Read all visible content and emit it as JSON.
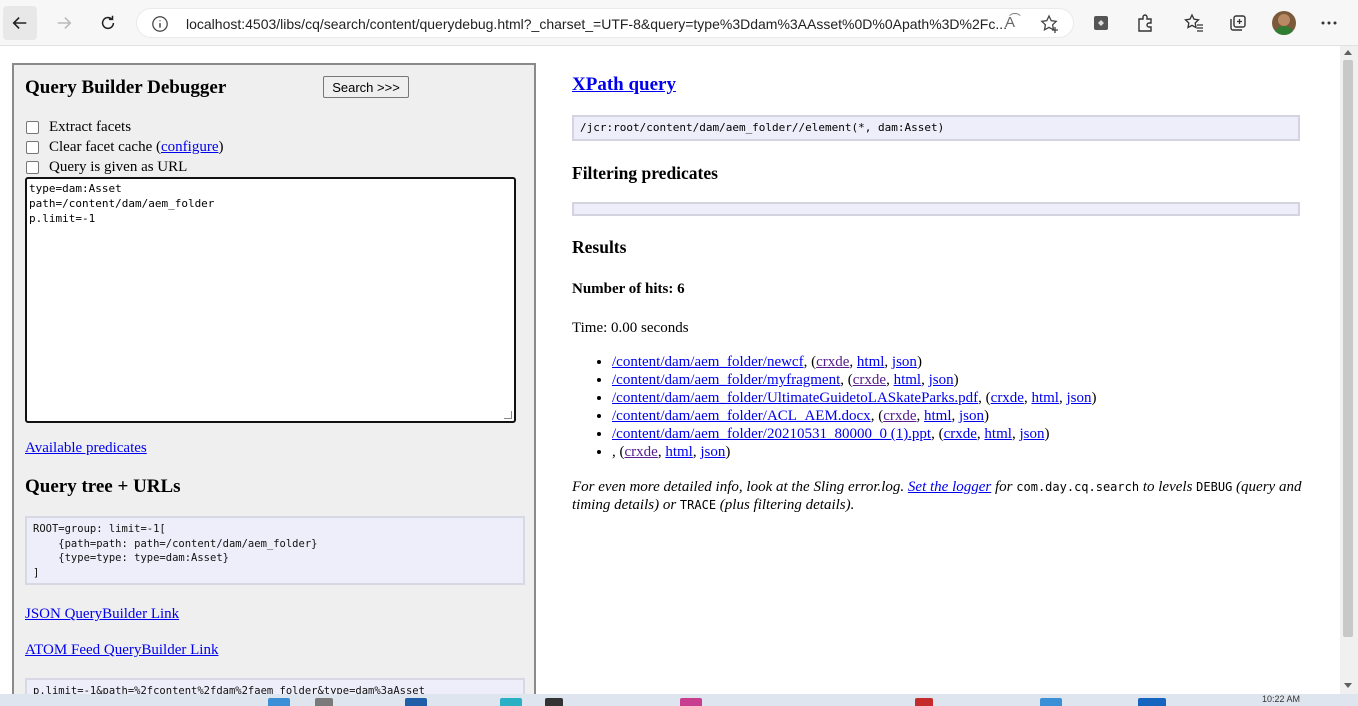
{
  "browser": {
    "url": "localhost:4503/libs/cq/search/content/querydebug.html?_charset_=UTF-8&query=type%3Ddam%3AAsset%0D%0Apath%3D%2Fc...",
    "reader_label": "A͡"
  },
  "left": {
    "title": "Query Builder Debugger",
    "search_button": "Search >>>",
    "checkboxes": {
      "extract": "Extract facets",
      "clear_prefix": "Clear facet cache (",
      "configure": "configure",
      "clear_suffix": ")",
      "url": "Query is given as URL"
    },
    "query_text": "type=dam:Asset\npath=/content/dam/aem_folder\np.limit=-1",
    "available_predicates": "Available predicates",
    "tree_heading": "Query tree + URLs",
    "tree_text": "ROOT=group: limit=-1[\n    {path=path: path=/content/dam/aem_folder}\n    {type=type: type=dam:Asset}\n]",
    "json_link": "JSON QueryBuilder Link",
    "atom_link": "ATOM Feed QueryBuilder Link",
    "url_text": "p.limit=-1&path=%2fcontent%2fdam%2faem_folder&type=dam%3aAsset"
  },
  "right": {
    "xpath_heading": "XPath query",
    "xpath": "/jcr:root/content/dam/aem_folder//element(*, dam:Asset)",
    "filtering_heading": "Filtering predicates",
    "results_heading": "Results",
    "hits": "Number of hits: 6",
    "time": "Time: 0.00 seconds",
    "results": [
      {
        "path": "/content/dam/aem_folder/newcf",
        "sep": ", (",
        "crxde": "crxde",
        "html": "html",
        "json": "json",
        "end": ")"
      },
      {
        "path": "/content/dam/aem_folder/myfragment",
        "sep": ", (",
        "crxde": "crxde",
        "html": "html",
        "json": "json",
        "end": ")"
      },
      {
        "path": "/content/dam/aem_folder/UltimateGuidetoLASkateParks.pdf",
        "sep": ", (",
        "crxde": "crxde",
        "html": "html",
        "json": "json",
        "end": ")"
      },
      {
        "path": "/content/dam/aem_folder/ACL_AEM.docx",
        "sep": ", (",
        "crxde": "crxde",
        "html": "html",
        "json": "json",
        "end": ")"
      },
      {
        "path": "/content/dam/aem_folder/20210531_80000_0 (1).ppt",
        "sep": ", (",
        "crxde": "crxde",
        "html": "html",
        "json": "json",
        "end": ")"
      },
      {
        "path": "",
        "sep": ", (",
        "crxde": "crxde",
        "html": "html",
        "json": "json",
        "end": ")"
      }
    ],
    "comma": ", ",
    "note": {
      "p1": "For even more detailed info, look at the Sling error.log. ",
      "logger_link": "Set the logger",
      "p2": " for ",
      "code1": "com.day.cq.search",
      "p3": " to levels ",
      "code2": "DEBUG",
      "p4": " (query and timing details) or ",
      "code3": "TRACE",
      "p5": " (plus filtering details)."
    }
  },
  "taskbar": {
    "clock": "10:22 AM"
  }
}
